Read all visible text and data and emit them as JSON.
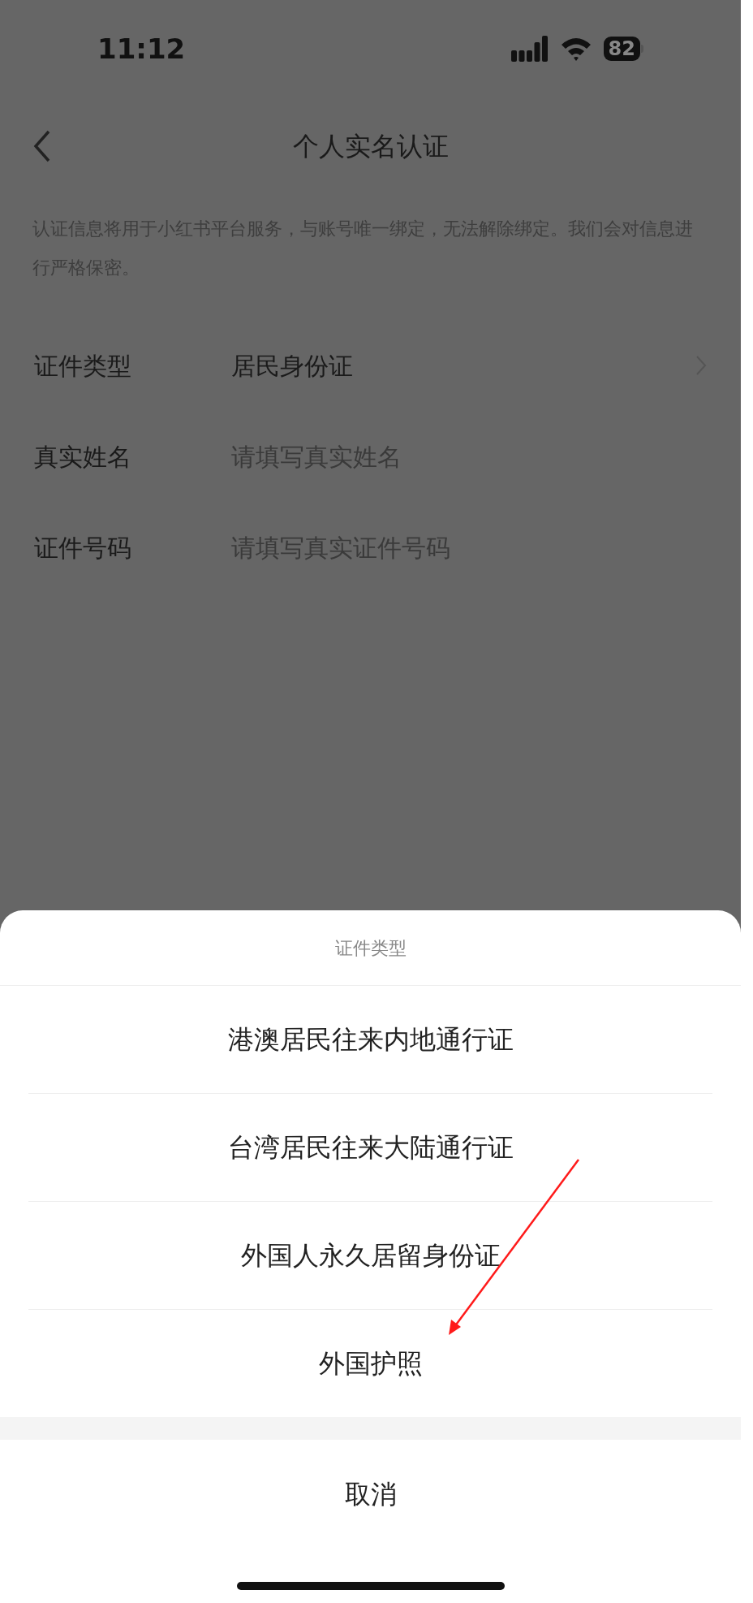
{
  "status_bar": {
    "time": "11:12",
    "battery": "82"
  },
  "nav": {
    "title": "个人实名认证"
  },
  "notice": "认证信息将用于小红书平台服务，与账号唯一绑定，无法解除绑定。我们会对信息进行严格保密。",
  "form": [
    {
      "kind": "select",
      "label": "证件类型",
      "value": "居民身份证"
    },
    {
      "kind": "input",
      "label": "真实姓名",
      "placeholder": "请填写真实姓名"
    },
    {
      "kind": "input",
      "label": "证件号码",
      "placeholder": "请填写真实证件号码"
    }
  ],
  "sheet": {
    "title": "证件类型",
    "options": [
      "港澳居民往来内地通行证",
      "台湾居民往来大陆通行证",
      "外国人永久居留身份证",
      "外国护照"
    ],
    "cancel": "取消"
  }
}
